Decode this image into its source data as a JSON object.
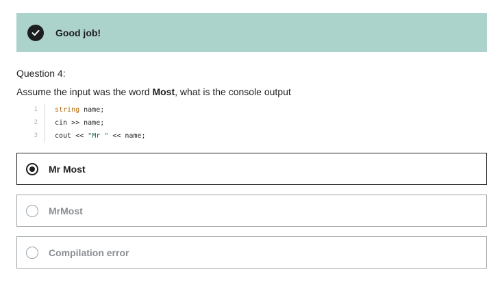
{
  "banner": {
    "icon": "check-icon",
    "text": "Good job!",
    "color": "#acd2cc"
  },
  "question": {
    "number_label": "Question 4:",
    "prompt_before": "Assume the input was the word ",
    "prompt_bold": "Most",
    "prompt_after": ", what is the console output"
  },
  "code": {
    "lines": [
      {
        "number": "1",
        "keyword": "string",
        "rest": " name;"
      },
      {
        "number": "2",
        "text": "cin >> name;"
      },
      {
        "number": "3",
        "text_before": "cout << ",
        "string_literal": "\"Mr \"",
        "text_after": " << name;"
      }
    ]
  },
  "options": [
    {
      "label": "Mr Most",
      "selected": true
    },
    {
      "label": "MrMost",
      "selected": false
    },
    {
      "label": "Compilation error",
      "selected": false
    }
  ]
}
